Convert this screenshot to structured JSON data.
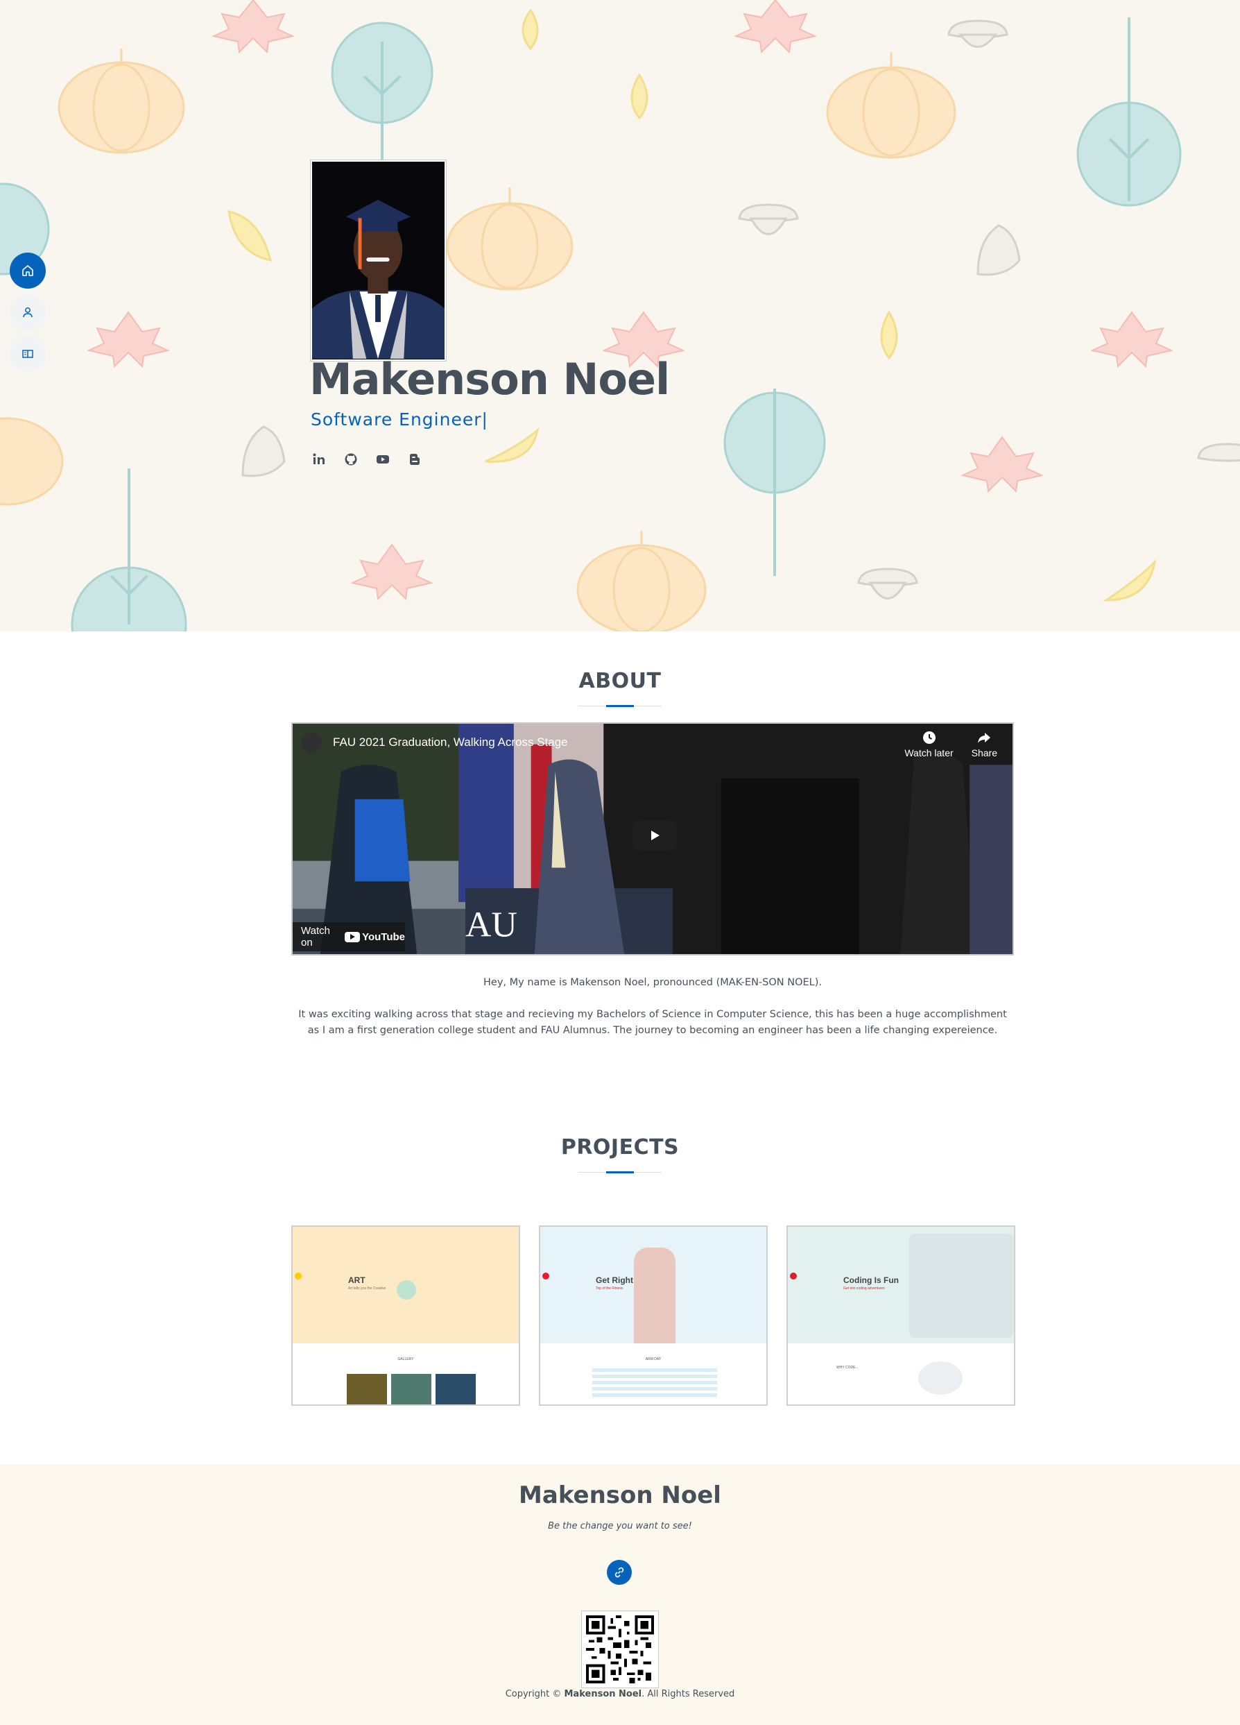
{
  "hero": {
    "name": "Makenson Noel",
    "role": "Software Engineer",
    "cursor": "|",
    "social": [
      "linkedin-icon",
      "github-icon",
      "youtube-icon",
      "blog-icon"
    ]
  },
  "nav": {
    "items": [
      "home-icon",
      "person-icon",
      "book-icon"
    ],
    "active": "home-icon"
  },
  "about": {
    "title": "ABOUT",
    "video": {
      "title": "FAU 2021 Graduation, Walking Across Stage",
      "watch_later": "Watch later",
      "share": "Share",
      "watch_on": "Watch on",
      "youtube": "YouTube"
    },
    "intro": "Hey, My name is Makenson Noel, pronounced (MAK-EN-SON NOEL).",
    "body": "It was exciting walking across that stage and recieving my Bachelors of Science in Computer Science, this has been a huge accomplishment as I am a first generation college student and FAU Alumnus. The journey to becoming an engineer has been a life changing expereience."
  },
  "projects": {
    "title": "PROJECTS",
    "cards": [
      {
        "title": "ART",
        "subtitle": "Art tells you the Creative",
        "section": "GALLERY"
      },
      {
        "title": "Get Right",
        "subtitle": "Top of the Fitness",
        "section": "ARM DAY"
      },
      {
        "title": "Coding Is Fun",
        "subtitle": "Get into coding adventures",
        "section": "WHY CODE..."
      }
    ]
  },
  "footer": {
    "name": "Makenson Noel",
    "quote": "Be the change you want to see!",
    "copyright_prefix": "Copyright ©",
    "copyright_name": "Makenson Noel",
    "copyright_suffix": ". All Rights Reserved"
  },
  "colors": {
    "accent": "#0563bb",
    "text": "#45505b",
    "hero_bg": "#f9f6ef",
    "footer_bg": "#fcf8ed"
  }
}
